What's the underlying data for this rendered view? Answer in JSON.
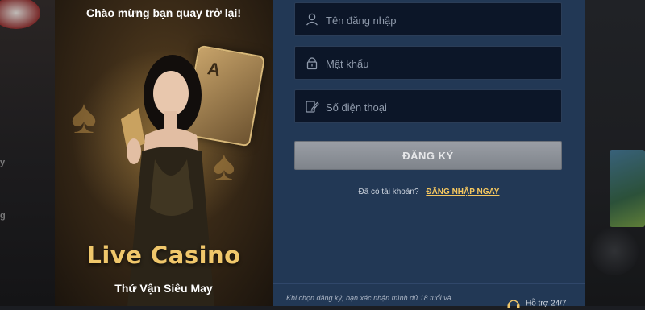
{
  "promo": {
    "welcome": "Chào mừng bạn quay trở lại!",
    "headline": "Live Casino",
    "subline": "Thứ Vận Siêu May",
    "card_letter": "A"
  },
  "form": {
    "username_placeholder": "Tên đăng nhập",
    "password_placeholder": "Mật khẩu",
    "phone_placeholder": "Số điện thoại",
    "submit_label": "ĐĂNG KÝ",
    "have_account_text": "Đã có tài khoản?",
    "login_link": "ĐĂNG NHẬP NGAY"
  },
  "footer": {
    "terms_text": "Khi chọn đăng ký, bạn xác nhận mình đủ 18 tuổi và",
    "support_text": "Hỗ trợ 24/7"
  },
  "background": {
    "left_fragment_1": "y",
    "left_fragment_2": "g"
  },
  "colors": {
    "panel": "#223855",
    "field": "#0c1628",
    "accent_gold": "#f0c76b",
    "link": "#f6c85f"
  }
}
